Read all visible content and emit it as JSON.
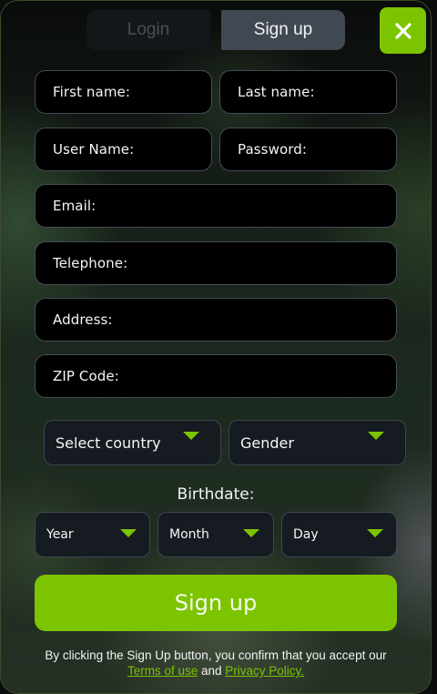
{
  "tabs": {
    "login_label": "Login",
    "signup_label": "Sign up"
  },
  "close_icon": "close-icon",
  "fields": {
    "first_name": "First name:",
    "last_name": "Last name:",
    "user_name": "User Name:",
    "password": "Password:",
    "email": "Email:",
    "telephone": "Telephone:",
    "address": "Address:",
    "zip": "ZIP Code:"
  },
  "selects": {
    "country": "Select country",
    "gender": "Gender"
  },
  "birthdate": {
    "label": "Birthdate:",
    "year": "Year",
    "month": "Month",
    "day": "Day"
  },
  "submit_label": "Sign up",
  "terms": {
    "text": "By clicking the Sign Up button, you confirm that you accept our",
    "terms_link": "Terms of use",
    "and": "and",
    "privacy_link": "Privacy Policy."
  },
  "colors": {
    "accent": "#7cc400",
    "field_bg": "#000000",
    "select_bg": "#161b22"
  }
}
